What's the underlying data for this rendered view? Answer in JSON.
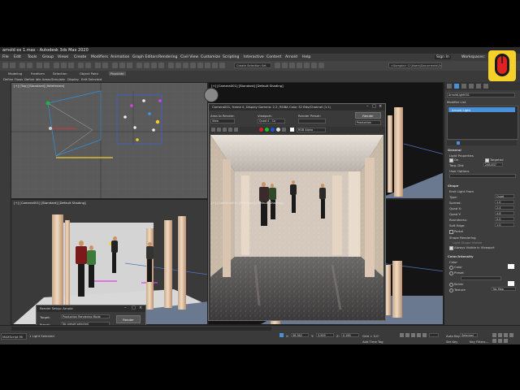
{
  "window": {
    "title": "arnold ex 1.max - Autodesk 3ds Max 2020",
    "sign_in": "Sign In",
    "workspaces_label": "Workspaces:",
    "path": "<Sample> C:\\Users\\Documents\\3ds Max 2020"
  },
  "menu": [
    "File",
    "Edit",
    "Tools",
    "Group",
    "Views",
    "Create",
    "Modifiers",
    "Animation",
    "Graph Editors",
    "Rendering",
    "Civil View",
    "Customize",
    "Scripting",
    "Interactive",
    "Content",
    "Arnold",
    "Help"
  ],
  "toolbar": {
    "selection_set": "Create Selection Set"
  },
  "ribbon": {
    "tabs": [
      "Modeling",
      "Freeform",
      "Selection",
      "Object Paint",
      "Populate"
    ],
    "items": [
      "Define Flows",
      "Define Idle Areas",
      "Simulate",
      "Display",
      "Edit Selected"
    ]
  },
  "viewports": {
    "top": "[+] [Top] [Standard] [Wireframe]",
    "camera_top_right": "[+] [Camera001] [Standard] [Default Shading]",
    "camera_bottom_left": "[+] [Camera001] [Standard] [Default Shading]",
    "perspective": "[+] [Camera001] [Standard] [Default Shading]"
  },
  "render_window": {
    "title": "Camera001, frame 0, Display Gamma: 2.2, RGBA Color 32 Bits/Channel (1:1)",
    "area_to_render_label": "Area to Render:",
    "area_to_render_value": "View",
    "viewport_label": "Viewport:",
    "viewport_value": "Quad 4 - Ca",
    "preset_label": "Render Preset:",
    "preset_value": "",
    "render_button": "Render",
    "production_value": "Production",
    "channel_value": "RGB Alpha"
  },
  "render_setup": {
    "title": "Render Setup: Arnold",
    "target_label": "Target:",
    "target_value": "Production Rendering Mode",
    "preset_label": "Preset:",
    "preset_value": "No preset selected",
    "renderer_label": "Renderer:",
    "renderer_value": "Arnold",
    "save_file_label": "Save File",
    "render_button": "Render"
  },
  "command_panel": {
    "object_name": "ArnoldLight001",
    "modifier_list": "Modifier List",
    "stack_item": "Arnold Light",
    "general_title": "General",
    "light_properties": "Light Properties",
    "on_label": "On",
    "targeted_label": "Targeted",
    "targ_dist_label": "Targ. Dist",
    "targ_dist_value": "248.837",
    "user_options_label": "User Options",
    "shape_title": "Shape",
    "emit_light_from": "Emit Light From",
    "type_label": "Type:",
    "type_value": "Quad",
    "spread_label": "Spread:",
    "spread_value": "1.0",
    "quad_x_label": "Quad X:",
    "quad_x_value": "2.4",
    "quad_y_label": "Quad Y:",
    "quad_y_value": "4.8",
    "roundness_label": "Roundness:",
    "roundness_value": "0.0",
    "soft_edge_label": "Soft Edge:",
    "soft_edge_value": "1.0",
    "portal_label": "Portal",
    "shape_rendering": "Shape Rendering",
    "light_shape_visible": "Light Shape Visible",
    "always_visible": "Always Visible in Viewport",
    "color_title": "Color/Intensity",
    "color_label": "Color",
    "color_value": "Color",
    "preset_label": "Preset",
    "kelvin_label": "Kelvin",
    "texture_label": "Texture",
    "no_map": "No Map"
  },
  "status": {
    "selection": "1 Light Selected",
    "frame": "0 / 100",
    "x_value": "56.362",
    "y_value": "3.909",
    "z_value": "0.169",
    "grid": "Grid = 0.0'",
    "add_time_tag": "Add Time Tag",
    "auto_key": "Auto Key",
    "set_key": "Set Key",
    "selected": "Selected",
    "key_filters": "Key Filters...",
    "maxscript": "MAXScript Mi"
  },
  "colors": {
    "accent_blue": "#4a90d9",
    "camera_cyan": "#23c8f0",
    "logo_yellow": "#f5d02a"
  },
  "icons": [
    "undo-icon",
    "redo-icon",
    "link-icon",
    "select-icon",
    "move-icon",
    "rotate-icon",
    "scale-icon",
    "render-teapot-icon",
    "mouse-logo-icon"
  ]
}
